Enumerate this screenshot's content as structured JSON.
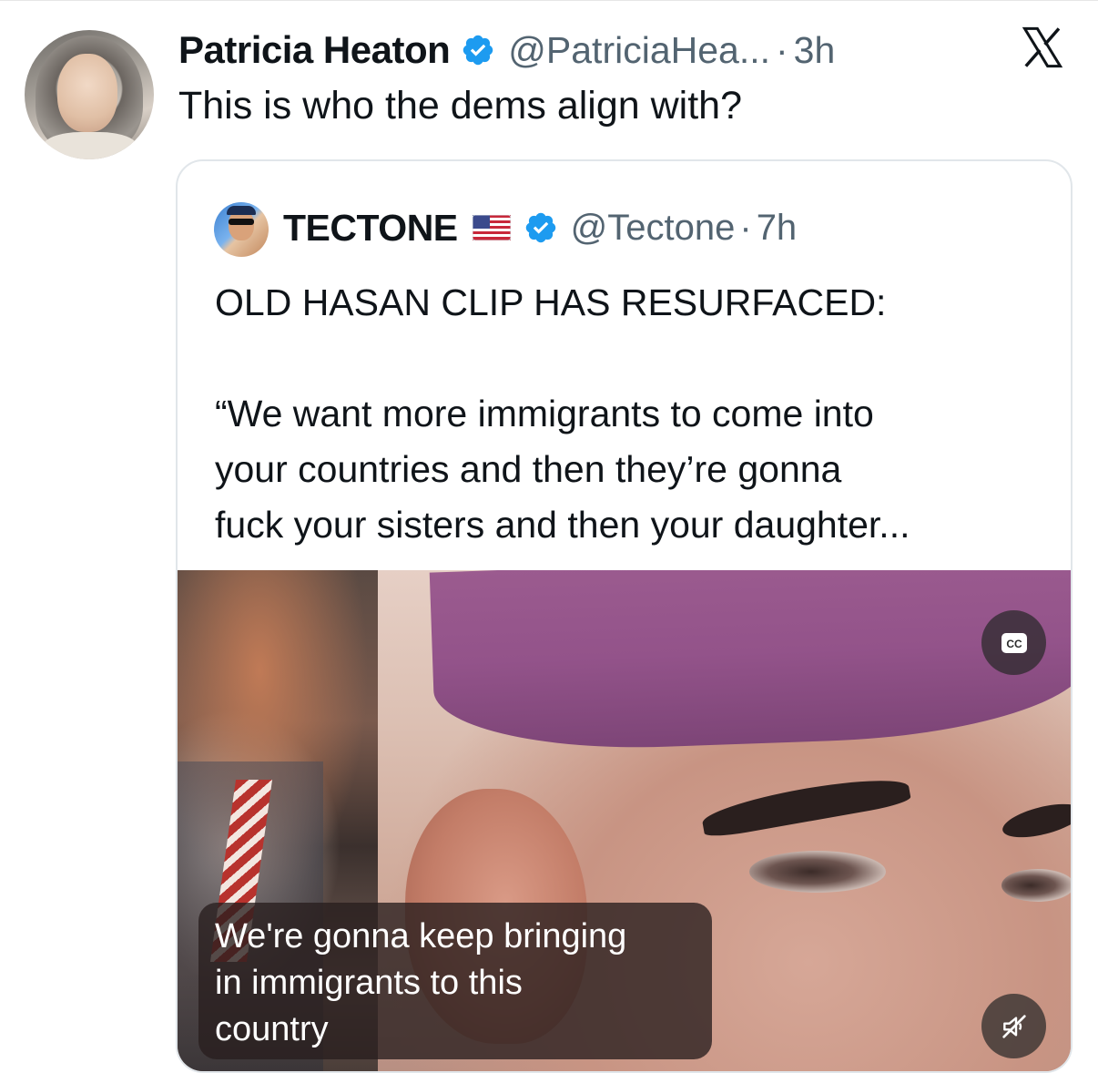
{
  "tweet": {
    "author_name": "Patricia Heaton",
    "author_handle": "@PatriciaHea...",
    "separator": "·",
    "time": "3h",
    "text": "This is who the dems align with?"
  },
  "quote": {
    "author_name": "TECTONE",
    "author_handle": "@Tectone",
    "separator": "·",
    "time": "7h",
    "lines": [
      "OLD HASAN CLIP HAS RESURFACED:",
      "“We want more immigrants to come into",
      "your countries and then they’re gonna",
      "fuck your sisters and then your daughter..."
    ]
  },
  "video": {
    "caption_lines": [
      "We're gonna keep bringing",
      "in immigrants to this",
      "country"
    ],
    "cc_label": "CC"
  },
  "colors": {
    "verified_blue": "#1d9bf0",
    "muted_text": "#536471",
    "text": "#0f1419"
  },
  "icons": {
    "verified": "verified-badge-icon",
    "x_logo": "x-logo-icon",
    "flag": "us-flag-icon",
    "cc": "closed-captions-icon",
    "mute": "muted-speaker-icon"
  }
}
